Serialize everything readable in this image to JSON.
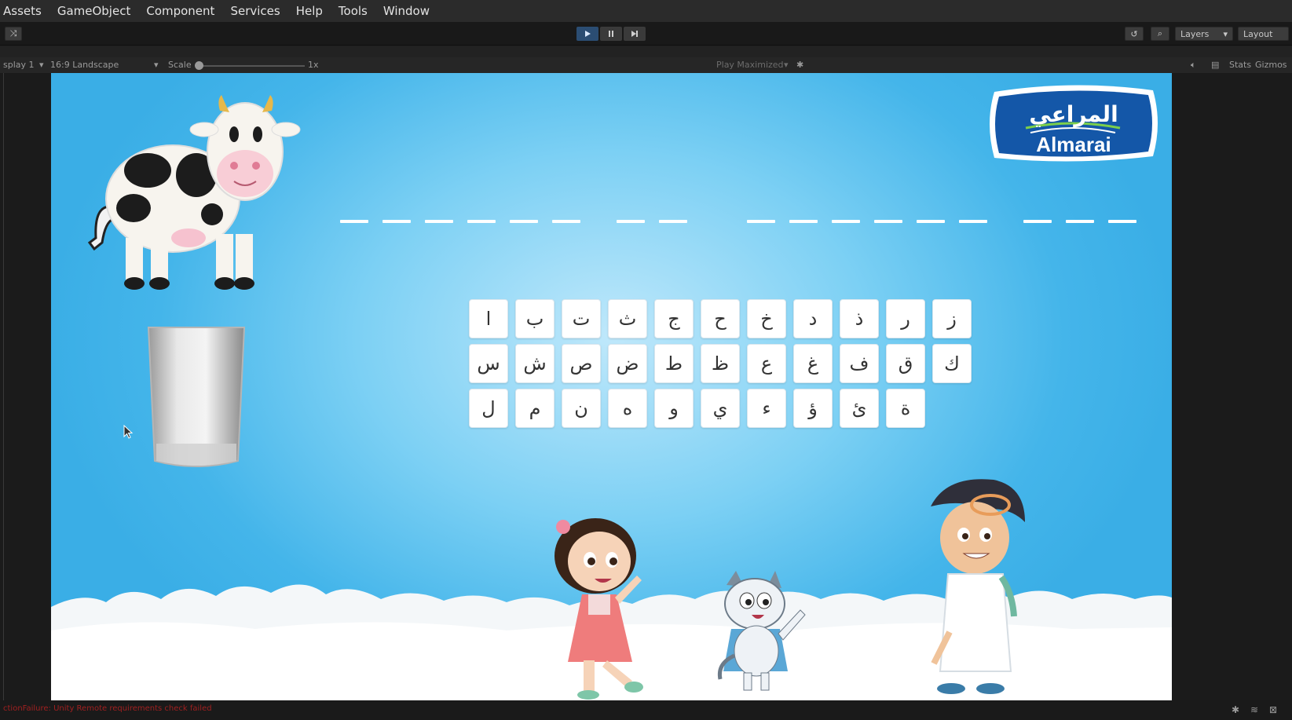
{
  "menubar": {
    "items": [
      "Assets",
      "GameObject",
      "Component",
      "Services",
      "Help",
      "Tools",
      "Window"
    ]
  },
  "toolbar": {
    "play_icon": "play-icon",
    "pause_icon": "pause-icon",
    "step_icon": "step-icon",
    "layers_label": "Layers",
    "layout_label": "Layout"
  },
  "gameview": {
    "display_label": "splay 1",
    "aspect_label": "16:9 Landscape",
    "scale_label": "Scale",
    "scale_value": "1x",
    "play_maximized_label": "Play Maximized",
    "stats_label": "Stats",
    "gizmos_label": "Gizmos"
  },
  "game": {
    "logo_arabic": "المراعي",
    "logo_english": "Almarai",
    "letters_row1": [
      "ا",
      "ب",
      "ت",
      "ث",
      "ج",
      "ح",
      "خ",
      "د",
      "ذ",
      "ر",
      "ز"
    ],
    "letters_row2": [
      "س",
      "ش",
      "ص",
      "ض",
      "ط",
      "ظ",
      "ع",
      "غ",
      "ف",
      "ق",
      "ك"
    ],
    "letters_row3": [
      "ل",
      "م",
      "ن",
      "ه",
      "و",
      "ي",
      "ء",
      "ؤ",
      "ئ",
      "ة"
    ],
    "word_groups": [
      6,
      2,
      6,
      3
    ]
  },
  "status": {
    "message": "ctionFailure: Unity Remote requirements check failed"
  },
  "colors": {
    "sky": "#3aaee6",
    "play_active": "#2b4d73",
    "logo_blue": "#1457a8",
    "error_text": "#a02020"
  }
}
